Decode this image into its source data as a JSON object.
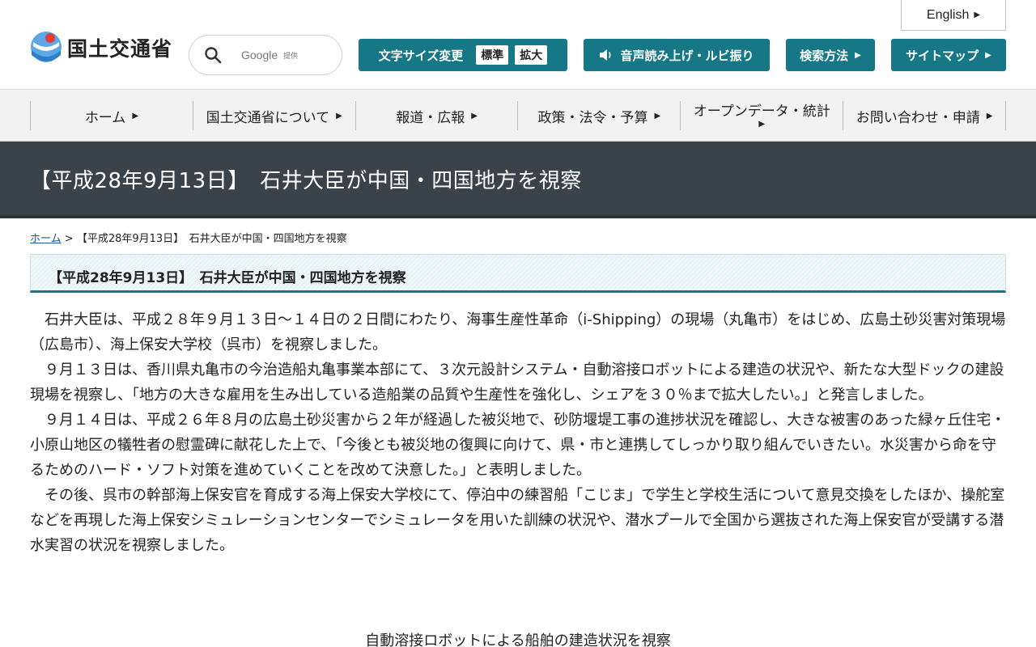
{
  "header": {
    "english_label": "English",
    "logo_text": "国土交通省",
    "search": {
      "placeholder": "Google",
      "provider_note": "提供"
    },
    "font_size": {
      "label": "文字サイズ変更",
      "standard": "標準",
      "large": "拡大"
    },
    "speech_label": "音声読み上げ・ルビ振り",
    "search_method_label": "検索方法",
    "sitemap_label": "サイトマップ"
  },
  "nav": {
    "items": [
      {
        "label": "ホーム"
      },
      {
        "label": "国土交通省について"
      },
      {
        "label": "報道・広報"
      },
      {
        "label": "政策・法令・予算"
      },
      {
        "label": "オープンデータ・統計"
      },
      {
        "label": "お問い合わせ・申請"
      }
    ]
  },
  "page": {
    "title": "【平成28年9月13日】　石井大臣が中国・四国地方を視察",
    "breadcrumb": {
      "home": "ホーム",
      "separator": ">",
      "current": "【平成28年9月13日】　石井大臣が中国・四国地方を視察"
    },
    "section_heading": "【平成28年9月13日】　石井大臣が中国・四国地方を視察",
    "paragraphs": [
      "石井大臣は、平成２８年９月１３日～１４日の２日間にわたり、海事生産性革命（i-Shipping）の現場（丸亀市）をはじめ、広島土砂災害対策現場（広島市）、海上保安大学校（呉市）を視察しました。",
      "９月１３日は、香川県丸亀市の今治造船丸亀事業本部にて、３次元設計システム・自動溶接ロボットによる建造の状況や、新たな大型ドックの建設現場を視察し、「地方の大きな雇用を生み出している造船業の品質や生産性を強化し、シェアを３０％まで拡大したい。」と発言しました。",
      "９月１４日は、平成２６年８月の広島土砂災害から２年が経過した被災地で、砂防堰堤工事の進捗状況を確認し、大きな被害のあった緑ヶ丘住宅・小原山地区の犠牲者の慰霊碑に献花した上で、「今後とも被災地の復興に向けて、県・市と連携してしっかり取り組んでいきたい。水災害から命を守るためのハード・ソフト対策を進めていくことを改めて決意した。」と表明しました。",
      "その後、呉市の幹部海上保安官を育成する海上保安大学校にて、停泊中の練習船「こじま」で学生と学校生活について意見交換をしたほか、操舵室などを再現した海上保安シミュレーションセンターでシミュレータを用いた訓練の状況や、潜水プールで全国から選抜された海上保安官が受講する潜水実習の状況を視察しました。"
    ],
    "photo_caption": "自動溶接ロボットによる船舶の建造状況を視察"
  }
}
